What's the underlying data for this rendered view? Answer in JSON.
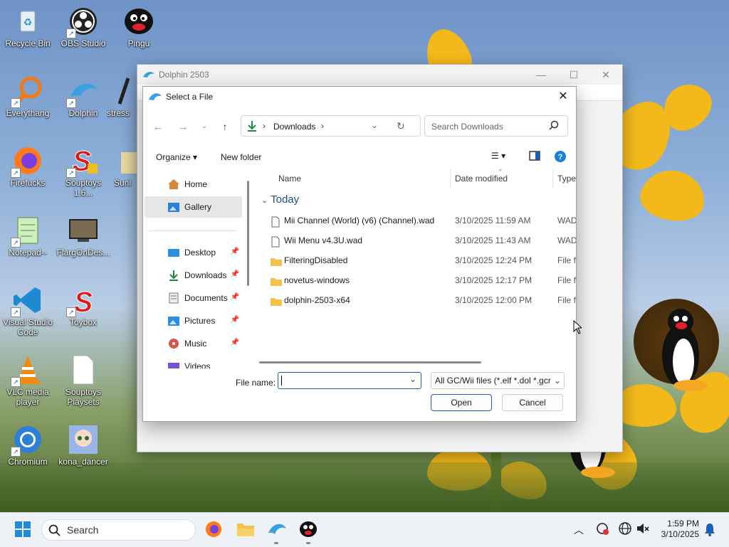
{
  "desktop": {
    "icons": [
      {
        "label": "Recycle Bin"
      },
      {
        "label": "OBS Studio"
      },
      {
        "label": "Pingu"
      },
      {
        "label": "Everythang"
      },
      {
        "label": "Dolphin"
      },
      {
        "label": "stress"
      },
      {
        "label": "Firefucks"
      },
      {
        "label": "Souptoys 1.6..."
      },
      {
        "label": "Suni"
      },
      {
        "label": "Notepad--"
      },
      {
        "label": "FlargOnDes..."
      },
      {
        "label": "Visual Studio Code"
      },
      {
        "label": "Toybox"
      },
      {
        "label": "VLC media player"
      },
      {
        "label": "Souptoys Playsets"
      },
      {
        "label": "Chromium"
      },
      {
        "label": "kona_dancer"
      }
    ]
  },
  "main_window": {
    "title": "Dolphin 2503",
    "controls": {
      "minimize": "—",
      "maximize": "☐",
      "close": "✕"
    }
  },
  "dialog": {
    "title": "Select a File",
    "close": "✕",
    "address": {
      "location": "Downloads"
    },
    "search": {
      "placeholder": "Search Downloads"
    },
    "commands": {
      "organize": "Organize",
      "new_folder": "New folder"
    },
    "sidebar": {
      "items": [
        {
          "label": "Home"
        },
        {
          "label": "Gallery"
        },
        {
          "label": "Desktop"
        },
        {
          "label": "Downloads"
        },
        {
          "label": "Documents"
        },
        {
          "label": "Pictures"
        },
        {
          "label": "Music"
        },
        {
          "label": "Videos"
        }
      ]
    },
    "columns": {
      "name": "Name",
      "date": "Date modified",
      "type": "Type"
    },
    "group": "Today",
    "files": [
      {
        "name": "Mii Channel (World) (v6) (Channel).wad",
        "date": "3/10/2025 11:59 AM",
        "type": "WAD",
        "kind": "file"
      },
      {
        "name": "Wii Menu v4.3U.wad",
        "date": "3/10/2025 11:43 AM",
        "type": "WAD",
        "kind": "file"
      },
      {
        "name": "FilteringDisabled",
        "date": "3/10/2025 12:24 PM",
        "type": "File fo",
        "kind": "folder"
      },
      {
        "name": "novetus-windows",
        "date": "3/10/2025 12:17 PM",
        "type": "File fo",
        "kind": "folder"
      },
      {
        "name": "dolphin-2503-x64",
        "date": "3/10/2025 12:00 PM",
        "type": "File fo",
        "kind": "folder"
      }
    ],
    "file_name_label": "File name:",
    "file_name_value": "",
    "filter": "All GC/Wii files (*.elf *.dol *.gcr",
    "open_button": "Open",
    "cancel_button": "Cancel"
  },
  "taskbar": {
    "search_placeholder": "Search",
    "time": "1:59 PM",
    "date": "3/10/2025"
  },
  "colors": {
    "accent": "#1a5fb4",
    "folder": "#f4c24a",
    "selected": "#e6e6e6"
  }
}
